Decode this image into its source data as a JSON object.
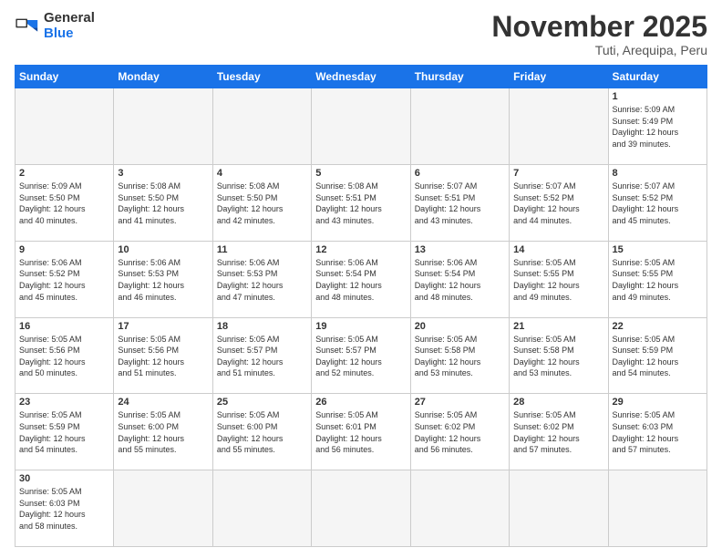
{
  "header": {
    "logo_general": "General",
    "logo_blue": "Blue",
    "month_title": "November 2025",
    "location": "Tuti, Arequipa, Peru"
  },
  "weekdays": [
    "Sunday",
    "Monday",
    "Tuesday",
    "Wednesday",
    "Thursday",
    "Friday",
    "Saturday"
  ],
  "weeks": [
    [
      {
        "num": "",
        "info": "",
        "empty": true
      },
      {
        "num": "",
        "info": "",
        "empty": true
      },
      {
        "num": "",
        "info": "",
        "empty": true
      },
      {
        "num": "",
        "info": "",
        "empty": true
      },
      {
        "num": "",
        "info": "",
        "empty": true
      },
      {
        "num": "",
        "info": "",
        "empty": true
      },
      {
        "num": "1",
        "info": "Sunrise: 5:09 AM\nSunset: 5:49 PM\nDaylight: 12 hours\nand 39 minutes.",
        "empty": false
      }
    ],
    [
      {
        "num": "2",
        "info": "Sunrise: 5:09 AM\nSunset: 5:50 PM\nDaylight: 12 hours\nand 40 minutes.",
        "empty": false
      },
      {
        "num": "3",
        "info": "Sunrise: 5:08 AM\nSunset: 5:50 PM\nDaylight: 12 hours\nand 41 minutes.",
        "empty": false
      },
      {
        "num": "4",
        "info": "Sunrise: 5:08 AM\nSunset: 5:50 PM\nDaylight: 12 hours\nand 42 minutes.",
        "empty": false
      },
      {
        "num": "5",
        "info": "Sunrise: 5:08 AM\nSunset: 5:51 PM\nDaylight: 12 hours\nand 43 minutes.",
        "empty": false
      },
      {
        "num": "6",
        "info": "Sunrise: 5:07 AM\nSunset: 5:51 PM\nDaylight: 12 hours\nand 43 minutes.",
        "empty": false
      },
      {
        "num": "7",
        "info": "Sunrise: 5:07 AM\nSunset: 5:52 PM\nDaylight: 12 hours\nand 44 minutes.",
        "empty": false
      },
      {
        "num": "8",
        "info": "Sunrise: 5:07 AM\nSunset: 5:52 PM\nDaylight: 12 hours\nand 45 minutes.",
        "empty": false
      }
    ],
    [
      {
        "num": "9",
        "info": "Sunrise: 5:06 AM\nSunset: 5:52 PM\nDaylight: 12 hours\nand 45 minutes.",
        "empty": false
      },
      {
        "num": "10",
        "info": "Sunrise: 5:06 AM\nSunset: 5:53 PM\nDaylight: 12 hours\nand 46 minutes.",
        "empty": false
      },
      {
        "num": "11",
        "info": "Sunrise: 5:06 AM\nSunset: 5:53 PM\nDaylight: 12 hours\nand 47 minutes.",
        "empty": false
      },
      {
        "num": "12",
        "info": "Sunrise: 5:06 AM\nSunset: 5:54 PM\nDaylight: 12 hours\nand 48 minutes.",
        "empty": false
      },
      {
        "num": "13",
        "info": "Sunrise: 5:06 AM\nSunset: 5:54 PM\nDaylight: 12 hours\nand 48 minutes.",
        "empty": false
      },
      {
        "num": "14",
        "info": "Sunrise: 5:05 AM\nSunset: 5:55 PM\nDaylight: 12 hours\nand 49 minutes.",
        "empty": false
      },
      {
        "num": "15",
        "info": "Sunrise: 5:05 AM\nSunset: 5:55 PM\nDaylight: 12 hours\nand 49 minutes.",
        "empty": false
      }
    ],
    [
      {
        "num": "16",
        "info": "Sunrise: 5:05 AM\nSunset: 5:56 PM\nDaylight: 12 hours\nand 50 minutes.",
        "empty": false
      },
      {
        "num": "17",
        "info": "Sunrise: 5:05 AM\nSunset: 5:56 PM\nDaylight: 12 hours\nand 51 minutes.",
        "empty": false
      },
      {
        "num": "18",
        "info": "Sunrise: 5:05 AM\nSunset: 5:57 PM\nDaylight: 12 hours\nand 51 minutes.",
        "empty": false
      },
      {
        "num": "19",
        "info": "Sunrise: 5:05 AM\nSunset: 5:57 PM\nDaylight: 12 hours\nand 52 minutes.",
        "empty": false
      },
      {
        "num": "20",
        "info": "Sunrise: 5:05 AM\nSunset: 5:58 PM\nDaylight: 12 hours\nand 53 minutes.",
        "empty": false
      },
      {
        "num": "21",
        "info": "Sunrise: 5:05 AM\nSunset: 5:58 PM\nDaylight: 12 hours\nand 53 minutes.",
        "empty": false
      },
      {
        "num": "22",
        "info": "Sunrise: 5:05 AM\nSunset: 5:59 PM\nDaylight: 12 hours\nand 54 minutes.",
        "empty": false
      }
    ],
    [
      {
        "num": "23",
        "info": "Sunrise: 5:05 AM\nSunset: 5:59 PM\nDaylight: 12 hours\nand 54 minutes.",
        "empty": false
      },
      {
        "num": "24",
        "info": "Sunrise: 5:05 AM\nSunset: 6:00 PM\nDaylight: 12 hours\nand 55 minutes.",
        "empty": false
      },
      {
        "num": "25",
        "info": "Sunrise: 5:05 AM\nSunset: 6:00 PM\nDaylight: 12 hours\nand 55 minutes.",
        "empty": false
      },
      {
        "num": "26",
        "info": "Sunrise: 5:05 AM\nSunset: 6:01 PM\nDaylight: 12 hours\nand 56 minutes.",
        "empty": false
      },
      {
        "num": "27",
        "info": "Sunrise: 5:05 AM\nSunset: 6:02 PM\nDaylight: 12 hours\nand 56 minutes.",
        "empty": false
      },
      {
        "num": "28",
        "info": "Sunrise: 5:05 AM\nSunset: 6:02 PM\nDaylight: 12 hours\nand 57 minutes.",
        "empty": false
      },
      {
        "num": "29",
        "info": "Sunrise: 5:05 AM\nSunset: 6:03 PM\nDaylight: 12 hours\nand 57 minutes.",
        "empty": false
      }
    ],
    [
      {
        "num": "30",
        "info": "Sunrise: 5:05 AM\nSunset: 6:03 PM\nDaylight: 12 hours\nand 58 minutes.",
        "empty": false
      },
      {
        "num": "",
        "info": "",
        "empty": true
      },
      {
        "num": "",
        "info": "",
        "empty": true
      },
      {
        "num": "",
        "info": "",
        "empty": true
      },
      {
        "num": "",
        "info": "",
        "empty": true
      },
      {
        "num": "",
        "info": "",
        "empty": true
      },
      {
        "num": "",
        "info": "",
        "empty": true
      }
    ]
  ]
}
